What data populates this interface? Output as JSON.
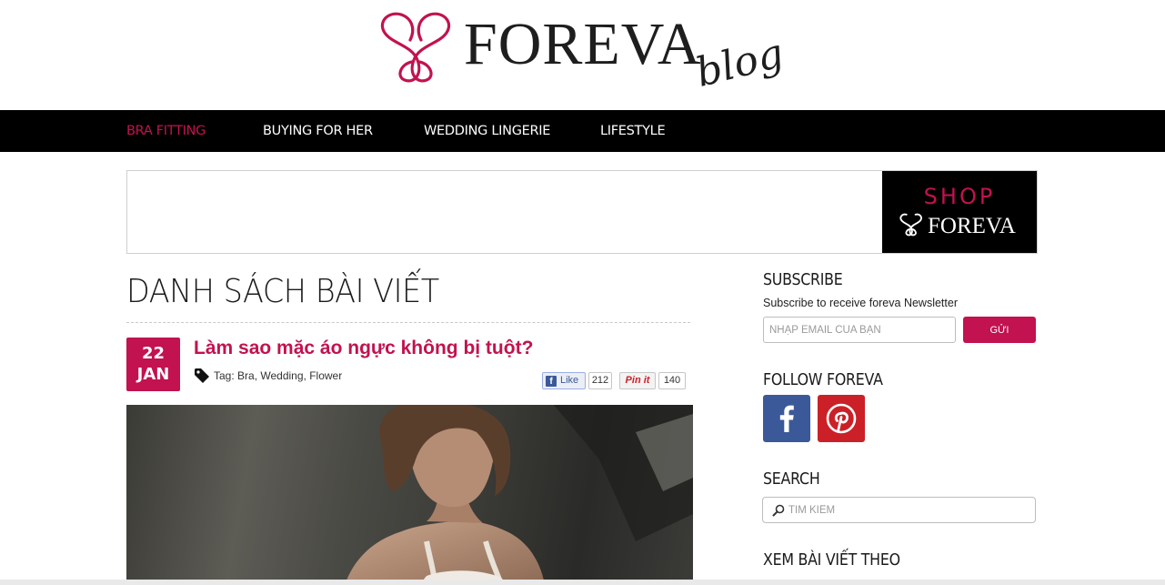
{
  "brand": {
    "name": "FOREVA",
    "script": "blog",
    "accent": "#c2124f"
  },
  "nav": {
    "items": [
      "BRA FITTING",
      "BUYING FOR HER",
      "WEDDING LINGERIE",
      "LIFESTYLE"
    ],
    "active_index": 0
  },
  "banner": {
    "shop_label": "SHOP",
    "shop_brand": "FOREVA"
  },
  "main": {
    "page_title": "DANH SÁCH BÀI VIẾT",
    "post": {
      "date_day": "22",
      "date_month": "JAN",
      "title": "Làm sao mặc áo ngực không bị tuột?",
      "tag_prefix": "Tag: ",
      "tags": [
        "Bra",
        "Wedding",
        "Flower"
      ],
      "tag_separator": ", ",
      "like_label": "Like",
      "like_count": "212",
      "pin_label": "Pin it",
      "pin_count": "140"
    }
  },
  "sidebar": {
    "subscribe_title": "SUBSCRIBE",
    "subscribe_text": "Subscribe to receive foreva Newsletter",
    "email_placeholder": "NHẬP EMAIL CỦA BẠN",
    "send_label": "GỬI",
    "follow_title": "FOLLOW FOREVA",
    "facebook_icon": "facebook-icon",
    "facebook_color": "#3b5998",
    "pinterest_icon": "pinterest-icon",
    "pinterest_color": "#cb2027",
    "search_title": "SEARCH",
    "search_placeholder": "TÌM KIẾM",
    "browse_title": "XEM BÀI VIẾT THEO"
  }
}
